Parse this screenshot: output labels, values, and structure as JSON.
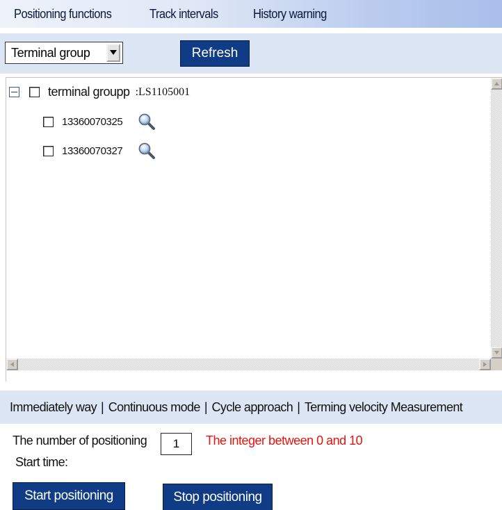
{
  "nav": {
    "tabs": [
      {
        "label": "Positioning functions"
      },
      {
        "label": "Track intervals"
      },
      {
        "label": "History warning"
      }
    ]
  },
  "toolbar": {
    "group_select_value": "Terminal group",
    "refresh_label": "Refresh"
  },
  "tree": {
    "group": {
      "label": "terminal groupp",
      "code": ":LS1105001"
    },
    "terminals": [
      {
        "number": "13360070325"
      },
      {
        "number": "13360070327"
      }
    ]
  },
  "modes": [
    {
      "label": "Immediately way"
    },
    {
      "label": "Continuous mode"
    },
    {
      "label": "Cycle approach"
    },
    {
      "label": "Terming velocity Measurement"
    }
  ],
  "mode_separator": "|",
  "form": {
    "count_label": "The number of positioning",
    "count_value": "1",
    "count_hint": "The integer between 0 and 10",
    "start_time_label": "Start time:"
  },
  "actions": {
    "start_label": "Start positioning",
    "stop_label": "Stop positioning"
  },
  "colors": {
    "button_blue": "#0f3c84",
    "panel_bg": "#dde6f4",
    "hint_red": "#e8130c"
  }
}
